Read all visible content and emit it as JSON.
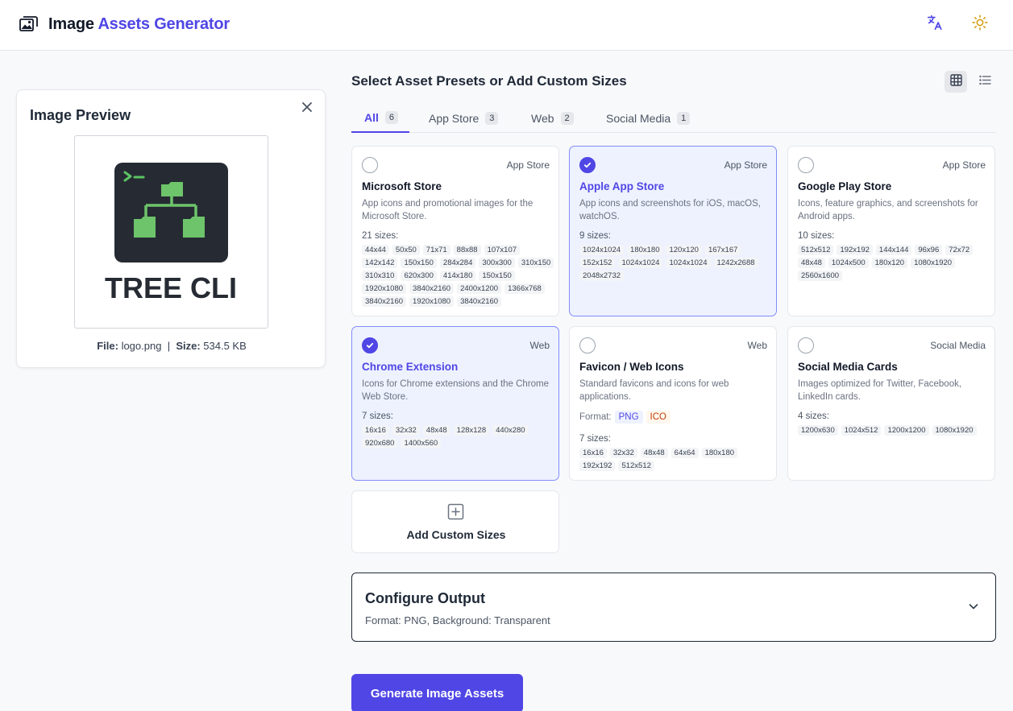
{
  "header": {
    "title_main": "Image",
    "title_accent": "Assets Generator",
    "logo_icon": "image-stack-icon",
    "language_icon": "translate-icon",
    "theme_icon": "sun-icon",
    "accent_color": "#4f46e5"
  },
  "preview": {
    "title": "Image Preview",
    "close_icon": "close-icon",
    "image_text": "TREE CLI",
    "file_label": "File:",
    "file_name": "logo.png",
    "separator": "|",
    "size_label": "Size:",
    "size_value": "534.5 KB"
  },
  "presets": {
    "title": "Select Asset Presets or Add Custom Sizes",
    "view_grid_icon": "grid-view-icon",
    "view_list_icon": "list-view-icon",
    "tabs": [
      {
        "label": "All",
        "count": "6",
        "active": true
      },
      {
        "label": "App Store",
        "count": "3",
        "active": false
      },
      {
        "label": "Web",
        "count": "2",
        "active": false
      },
      {
        "label": "Social Media",
        "count": "1",
        "active": false
      }
    ],
    "cards": [
      {
        "category": "App Store",
        "name": "Microsoft Store",
        "selected": false,
        "description": "App icons and promotional images for the Microsoft Store.",
        "sizes_label": "21 sizes:",
        "sizes": [
          "44x44",
          "50x50",
          "71x71",
          "88x88",
          "107x107",
          "142x142",
          "150x150",
          "284x284",
          "300x300",
          "310x150",
          "310x310",
          "620x300",
          "414x180",
          "150x150",
          "1920x1080",
          "3840x2160",
          "2400x1200",
          "1366x768",
          "3840x2160",
          "1920x1080",
          "3840x2160"
        ]
      },
      {
        "category": "App Store",
        "name": "Apple App Store",
        "selected": true,
        "description": "App icons and screenshots for iOS, macOS, watchOS.",
        "sizes_label": "9 sizes:",
        "sizes": [
          "1024x1024",
          "180x180",
          "120x120",
          "167x167",
          "152x152",
          "1024x1024",
          "1024x1024",
          "1242x2688",
          "2048x2732"
        ]
      },
      {
        "category": "App Store",
        "name": "Google Play Store",
        "selected": false,
        "description": "Icons, feature graphics, and screenshots for Android apps.",
        "sizes_label": "10 sizes:",
        "sizes": [
          "512x512",
          "192x192",
          "144x144",
          "96x96",
          "72x72",
          "48x48",
          "1024x500",
          "180x120",
          "1080x1920",
          "2560x1600"
        ]
      },
      {
        "category": "Web",
        "name": "Chrome Extension",
        "selected": true,
        "description": "Icons for Chrome extensions and the Chrome Web Store.",
        "sizes_label": "7 sizes:",
        "sizes": [
          "16x16",
          "32x32",
          "48x48",
          "128x128",
          "440x280",
          "920x680",
          "1400x560"
        ]
      },
      {
        "category": "Web",
        "name": "Favicon / Web Icons",
        "selected": false,
        "description": "Standard favicons and icons for web applications.",
        "format_label": "Format:",
        "formats": [
          "PNG",
          "ICO"
        ],
        "sizes_label": "7 sizes:",
        "sizes": [
          "16x16",
          "32x32",
          "48x48",
          "64x64",
          "180x180",
          "192x192",
          "512x512"
        ]
      },
      {
        "category": "Social Media",
        "name": "Social Media Cards",
        "selected": false,
        "description": "Images optimized for Twitter, Facebook, LinkedIn cards.",
        "sizes_label": "4 sizes:",
        "sizes": [
          "1200x630",
          "1024x512",
          "1200x1200",
          "1080x1920"
        ]
      }
    ],
    "add_custom": {
      "label": "Add Custom Sizes",
      "icon": "plus-square-icon"
    }
  },
  "config": {
    "title": "Configure Output",
    "summary": "Format: PNG, Background: Transparent",
    "chevron_icon": "chevron-down-icon"
  },
  "generate_button": "Generate Image Assets"
}
